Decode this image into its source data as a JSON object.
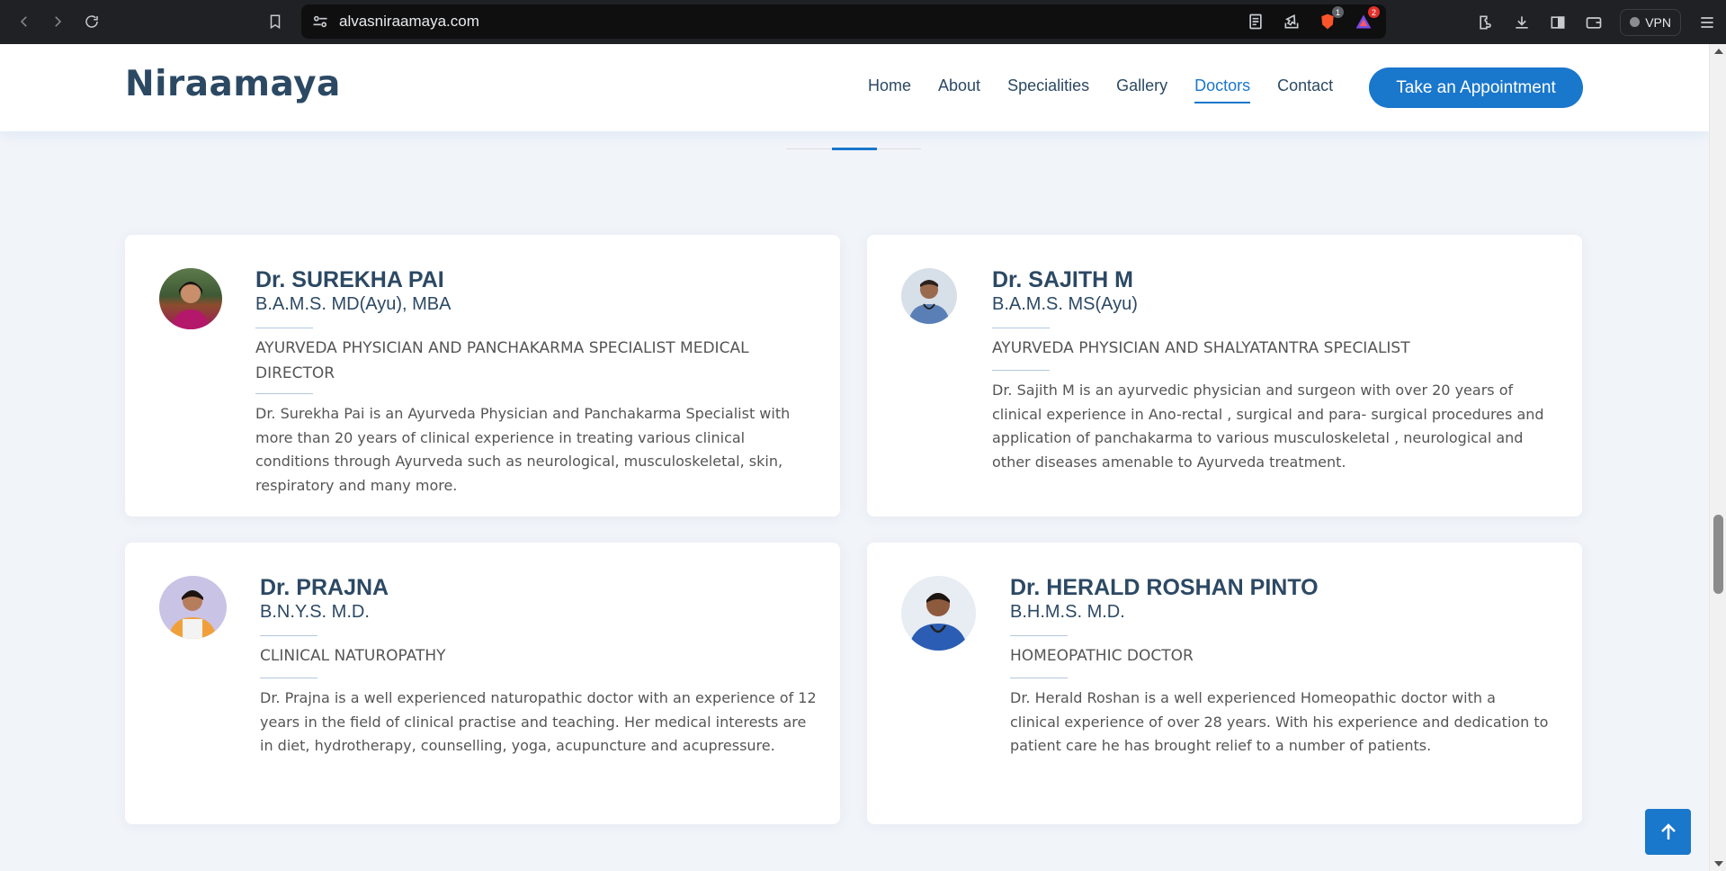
{
  "browser": {
    "url": "alvasniraamaya.com",
    "brave_shield_count": "1",
    "rewards_count": "2",
    "vpn_label": "VPN"
  },
  "site": {
    "logo": "Niraamaya",
    "nav": [
      "Home",
      "About",
      "Specialities",
      "Gallery",
      "Doctors",
      "Contact"
    ],
    "active_nav": "Doctors",
    "appointment_label": "Take an Appointment"
  },
  "doctors": [
    {
      "name": "Dr. SUREKHA PAI",
      "degree": "B.A.M.S. MD(Ayu), MBA",
      "role": "AYURVEDA PHYSICIAN AND PANCHAKARMA SPECIALIST MEDICAL DIRECTOR",
      "bio": "Dr. Surekha Pai is an Ayurveda Physician and Panchakarma Specialist with more than 20 years of clinical experience in treating various clinical conditions through Ayurveda such as neurological, musculoskeletal, skin, respiratory and many more."
    },
    {
      "name": "Dr. SAJITH M",
      "degree": "B.A.M.S. MS(Ayu)",
      "role": "AYURVEDA PHYSICIAN AND SHALYATANTRA SPECIALIST",
      "bio": "Dr. Sajith M is an ayurvedic physician and surgeon with over 20 years of clinical experience in Ano-rectal , surgical and para- surgical procedures and application of panchakarma to various musculoskeletal , neurological and other diseases amenable to Ayurveda treatment."
    },
    {
      "name": "Dr. PRAJNA",
      "degree": "B.N.Y.S. M.D.",
      "role": "CLINICAL NATUROPATHY",
      "bio": "Dr. Prajna is a well experienced naturopathic doctor with an experience of 12 years in the field of clinical practise and teaching. Her medical interests are in diet, hydrotherapy, counselling, yoga, acupuncture and acupressure."
    },
    {
      "name": "Dr. HERALD ROSHAN PINTO",
      "degree": "B.H.M.S. M.D.",
      "role": "HOMEOPATHIC DOCTOR",
      "bio": "Dr. Herald Roshan is a well experienced Homeopathic doctor with a clinical experience of over 28 years. With his experience and dedication to patient care he has brought relief to a number of patients."
    }
  ],
  "colors": {
    "brand": "#1977cc",
    "heading": "#2c4964"
  }
}
